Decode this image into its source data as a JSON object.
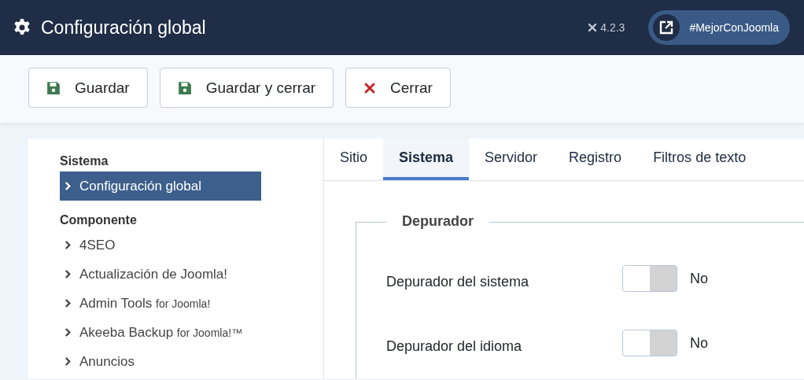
{
  "header": {
    "title": "Configuración global",
    "version": "4.2.3",
    "promo_button": "#MejorConJoomla"
  },
  "toolbar": [
    {
      "kind": "save",
      "label": "Guardar"
    },
    {
      "kind": "save",
      "label": "Guardar y cerrar"
    },
    {
      "kind": "close",
      "label": "Cerrar"
    }
  ],
  "sidebar": {
    "sections": [
      {
        "heading": "Sistema",
        "items": [
          {
            "label": "Configuración global",
            "selected": true
          }
        ]
      },
      {
        "heading": "Componente",
        "items": [
          {
            "label": "4SEO",
            "selected": false
          },
          {
            "label": "Actualización de Joomla!",
            "selected": false
          },
          {
            "label": "Admin Tools",
            "suffix": "for Joomla!",
            "selected": false
          },
          {
            "label": "Akeeba Backup",
            "suffix": "for Joomla!™",
            "selected": false
          },
          {
            "label": "Anuncios",
            "selected": false
          }
        ]
      }
    ]
  },
  "tabs": [
    {
      "label": "Sitio",
      "selected": false
    },
    {
      "label": "Sistema",
      "selected": true
    },
    {
      "label": "Servidor",
      "selected": false
    },
    {
      "label": "Registro",
      "selected": false
    },
    {
      "label": "Filtros de texto",
      "selected": false
    }
  ],
  "fieldset": {
    "legend": "Depurador",
    "fields": [
      {
        "label": "Depurador del sistema",
        "on": false,
        "value": "No"
      },
      {
        "label": "Depurador del idioma",
        "on": false,
        "value": "No"
      }
    ]
  }
}
